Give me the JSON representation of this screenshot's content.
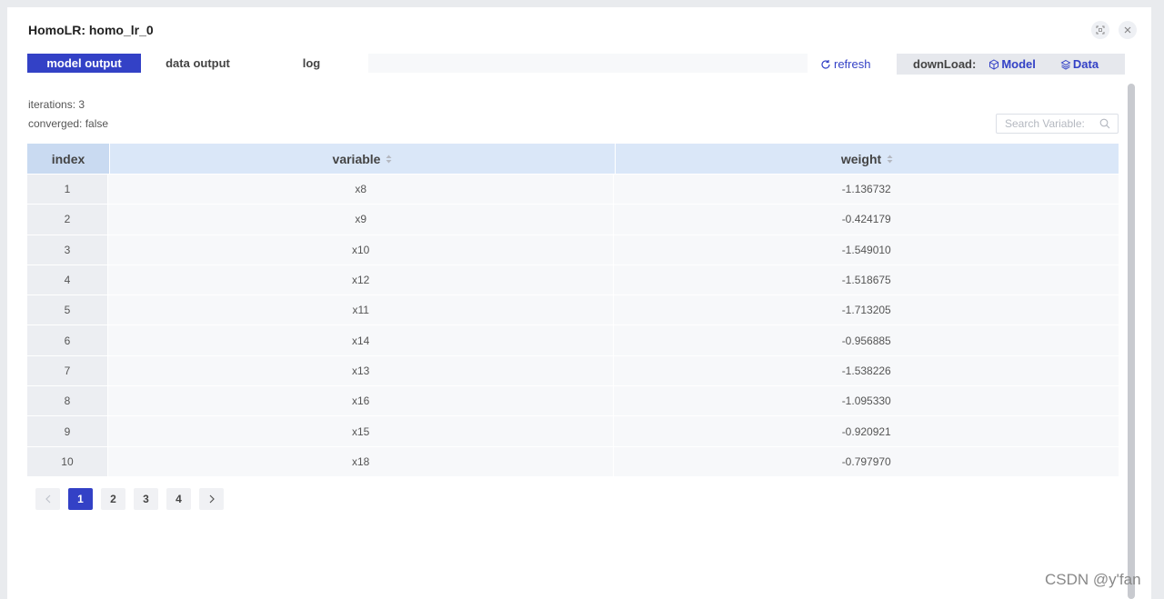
{
  "dialog": {
    "title": "HomoLR: homo_lr_0"
  },
  "tabs": [
    {
      "label": "model output",
      "active": true
    },
    {
      "label": "data output",
      "active": false
    },
    {
      "label": "log",
      "active": false
    }
  ],
  "refresh_label": "refresh",
  "download": {
    "label": "downLoad:",
    "model_label": "Model",
    "data_label": "Data"
  },
  "summary": {
    "iterations": "iterations: 3",
    "converged": "converged: false"
  },
  "search": {
    "placeholder": "Search Variable:"
  },
  "table": {
    "columns": [
      "index",
      "variable",
      "weight"
    ],
    "rows": [
      {
        "index": "1",
        "variable": "x8",
        "weight": "-1.136732"
      },
      {
        "index": "2",
        "variable": "x9",
        "weight": "-0.424179"
      },
      {
        "index": "3",
        "variable": "x10",
        "weight": "-1.549010"
      },
      {
        "index": "4",
        "variable": "x12",
        "weight": "-1.518675"
      },
      {
        "index": "5",
        "variable": "x11",
        "weight": "-1.713205"
      },
      {
        "index": "6",
        "variable": "x14",
        "weight": "-0.956885"
      },
      {
        "index": "7",
        "variable": "x13",
        "weight": "-1.538226"
      },
      {
        "index": "8",
        "variable": "x16",
        "weight": "-1.095330"
      },
      {
        "index": "9",
        "variable": "x15",
        "weight": "-0.920921"
      },
      {
        "index": "10",
        "variable": "x18",
        "weight": "-0.797970"
      }
    ]
  },
  "pagination": {
    "pages": [
      "1",
      "2",
      "3",
      "4"
    ],
    "current": "1"
  },
  "watermark": "CSDN @y'fan",
  "colors": {
    "accent": "#3341c6",
    "header_bg": "#dae7f8",
    "index_header_bg": "#c9daf1"
  }
}
